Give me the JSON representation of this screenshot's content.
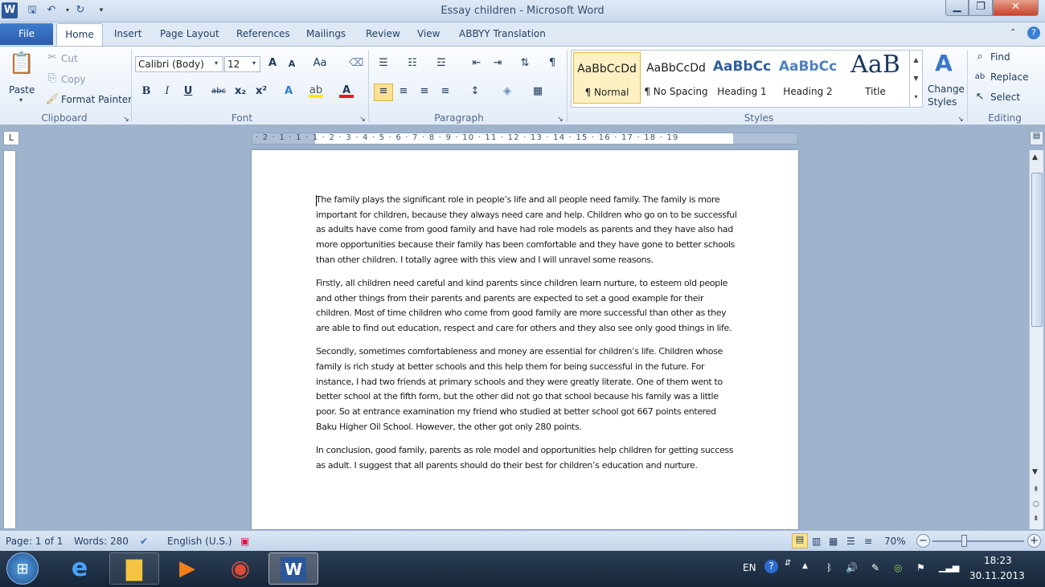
{
  "window": {
    "title": "Essay children  -  Microsoft Word",
    "minimize": "▁",
    "maximize": "❐",
    "close": "✕"
  },
  "tabs": {
    "file": "File",
    "home": "Home",
    "insert": "Insert",
    "page_layout": "Page Layout",
    "references": "References",
    "mailings": "Mailings",
    "review": "Review",
    "view": "View",
    "abbyy": "ABBYY Translation"
  },
  "clipboard": {
    "paste": "Paste",
    "cut": "Cut",
    "copy": "Copy",
    "format_painter": "Format Painter",
    "label": "Clipboard"
  },
  "font": {
    "name": "Calibri (Body)",
    "size": "12",
    "label": "Font",
    "grow": "A",
    "shrink": "A",
    "change_case": "Aa",
    "bold": "B",
    "italic": "I",
    "underline": "U",
    "strike": "abc",
    "subscript": "x₂",
    "superscript": "x²"
  },
  "paragraph": {
    "label": "Paragraph"
  },
  "styles": {
    "label": "Styles",
    "items": [
      {
        "preview": "AaBbCcDd",
        "name": "¶ Normal"
      },
      {
        "preview": "AaBbCcDd",
        "name": "¶ No Spacing"
      },
      {
        "preview": "AaBbCc",
        "name": "Heading 1"
      },
      {
        "preview": "AaBbCc",
        "name": "Heading 2"
      },
      {
        "preview": "AaB",
        "name": "Title"
      }
    ],
    "change_styles_1": "Change",
    "change_styles_2": "Styles"
  },
  "editing": {
    "find": "Find",
    "replace": "Replace",
    "select": "Select",
    "label": "Editing"
  },
  "ruler": {
    "marks": "· 2 · 1 · 1 · 1 · 2 · 3 · 4 · 5 · 6 · 7 · 8 · 9 · 10 · 11 · 12 · 13 · 14 · 15 · 16 · 17 · 18 · 19"
  },
  "document": {
    "paragraphs": [
      "The family plays the significant role in people’s life and all people  need family. The family is more important for children, because they always need care and help. Children who go on to be successful as adults have come from good family and have had role models as parents and they have also had more opportunities because their family has been comfortable and they have gone to better schools than other children. I totally agree with this view and I will unravel some reasons.",
      "Firstly, all children  need careful and kind  parents since children  learn nurture, to esteem old people and other things from their parents and parents are expected to set a good example for their children. Most of time children who come from good family are more successful than other as they are able to find out education, respect and care for others and they also see only good things in life.",
      "Secondly,  sometimes comfortableness and money  are essential for children’s life.  Children whose family is rich study at better schools  and this help them for being successful in the future. For instance, I had two friends at primary schools and they were greatly literate. One of them went to better school at the fifth form, but the other did  not go that school because his family was a little poor.  So at entrance examination my friend who studied at better school got 667 points entered Baku Higher Oil School.  However, the other got only 280 points.",
      "In conclusion, good family, parents as role model and opportunities help children for getting success as adult. I suggest that all parents should  do their best for children’s  education and nurture."
    ]
  },
  "status": {
    "page": "Page: 1 of 1",
    "words": "Words: 280",
    "language": "English (U.S.)",
    "zoom": "70%",
    "zoom_out": "−",
    "zoom_in": "+"
  },
  "taskbar": {
    "lang": "EN",
    "time": "18:23",
    "date": "30.11.2013"
  }
}
